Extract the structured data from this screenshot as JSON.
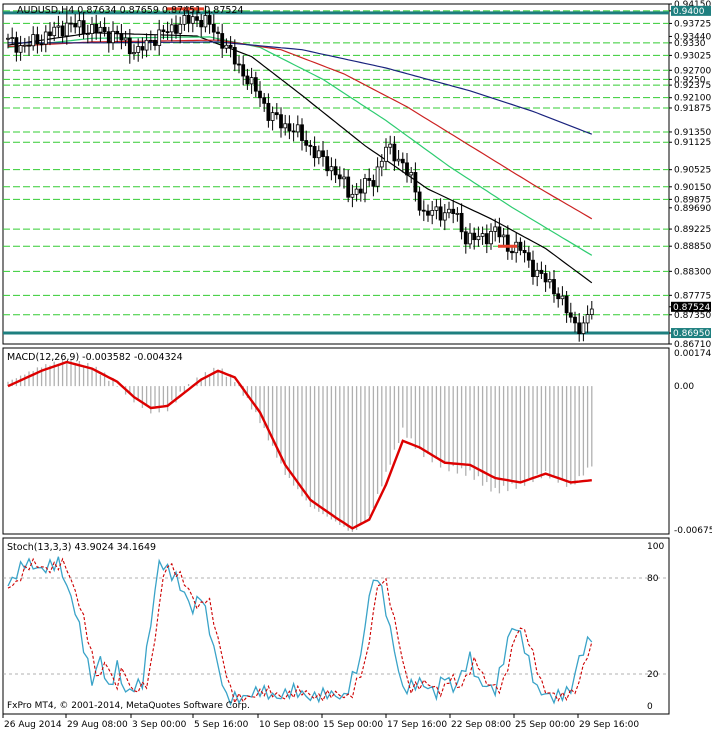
{
  "main": {
    "symbol_header": "AUDUSD,H4  0.87634 0.87659 0.87451 0.87524",
    "y_labels": [
      "0.94150",
      "0.9400",
      "0.93725",
      "0.93440",
      "0.9330",
      "0.93025",
      "0.92700",
      "0.9250",
      "0.92375",
      "0.92100",
      "0.91875",
      "0.91350",
      "0.91125",
      "0.90525",
      "0.90150",
      "0.89875",
      "0.89690",
      "0.89225",
      "0.88850",
      "0.88300",
      "0.87775",
      "0.87524",
      "0.87350",
      "0.86950",
      "0.86710"
    ],
    "hline_levels": [
      0.94,
      0.93725,
      0.933,
      0.93025,
      0.927,
      0.925,
      0.92375,
      0.921,
      0.91875,
      0.9135,
      0.91125,
      0.90525,
      0.9015,
      0.89875,
      0.89225,
      0.8885,
      0.883,
      0.87775,
      0.8735
    ],
    "support_level": "0.86950",
    "resistance_level": "0.9400",
    "current_price": "0.87524",
    "ylim": [
      0.8671,
      0.9415
    ]
  },
  "macd": {
    "header": "MACD(12,26,9) -0.003582 -0.004324",
    "y_labels": [
      "0.001741",
      "0.00",
      "-0.006756"
    ],
    "ylim": [
      -0.006756,
      0.001741
    ]
  },
  "stoch": {
    "header": "Stoch(13,3,3) 43.9024 34.1649",
    "y_labels": [
      "100",
      "80",
      "20",
      "0"
    ],
    "ylim": [
      0,
      100
    ]
  },
  "x_labels": [
    "26 Aug 2014",
    "29 Aug 08:00",
    "3 Sep 00:00",
    "5 Sep 16:00",
    "10 Sep 08:00",
    "15 Sep 00:00",
    "17 Sep 16:00",
    "22 Sep 08:00",
    "25 Sep 00:00",
    "29 Sep 16:00"
  ],
  "copyright": "FxPro MT4, © 2001-2014, MetaQuotes Software Corp.",
  "colors": {
    "support_line": "#1e7f7f",
    "resistance_mark": "#e8402a",
    "hlines": "#33cc33",
    "ma_fast": "#000000",
    "ma_mid": "#2ecc71",
    "ma_red": "#cc2222",
    "ma_blue": "#1a237e",
    "macd_signal": "#dd0000",
    "macd_hist": "#b0b0b0",
    "stoch_main": "#3aa3c8",
    "stoch_signal": "#cc0000"
  },
  "chart_data": {
    "type": "line",
    "title": "AUDUSD,H4",
    "x": [
      "26 Aug 2014",
      "29 Aug 08:00",
      "3 Sep 00:00",
      "5 Sep 16:00",
      "10 Sep 08:00",
      "15 Sep 00:00",
      "17 Sep 16:00",
      "22 Sep 08:00",
      "25 Sep 00:00",
      "29 Sep 16:00"
    ],
    "close": [
      0.9335,
      0.9335,
      0.9312,
      0.933,
      0.9165,
      0.905,
      0.901,
      0.888,
      0.883,
      0.8752
    ],
    "series": [
      {
        "name": "MACD(12,26,9) main",
        "values": [
          0.0002,
          0.001,
          -0.0003,
          0.0003,
          -0.0043,
          -0.0058,
          -0.0026,
          -0.0035,
          -0.0033,
          -0.0036
        ]
      },
      {
        "name": "MACD signal",
        "values": [
          0.0001,
          0.0008,
          -0.0002,
          0.0004,
          -0.004,
          -0.0056,
          -0.0028,
          -0.0034,
          -0.0034,
          -0.0043
        ]
      },
      {
        "name": "Stoch(13,3,3) main",
        "values": [
          75,
          90,
          8,
          60,
          9,
          10,
          82,
          12,
          50,
          43.9
        ]
      },
      {
        "name": "Stoch signal",
        "values": [
          72,
          86,
          12,
          58,
          10,
          12,
          76,
          15,
          46,
          34.2
        ]
      }
    ],
    "ylim": [
      0.8671,
      0.9415
    ]
  }
}
